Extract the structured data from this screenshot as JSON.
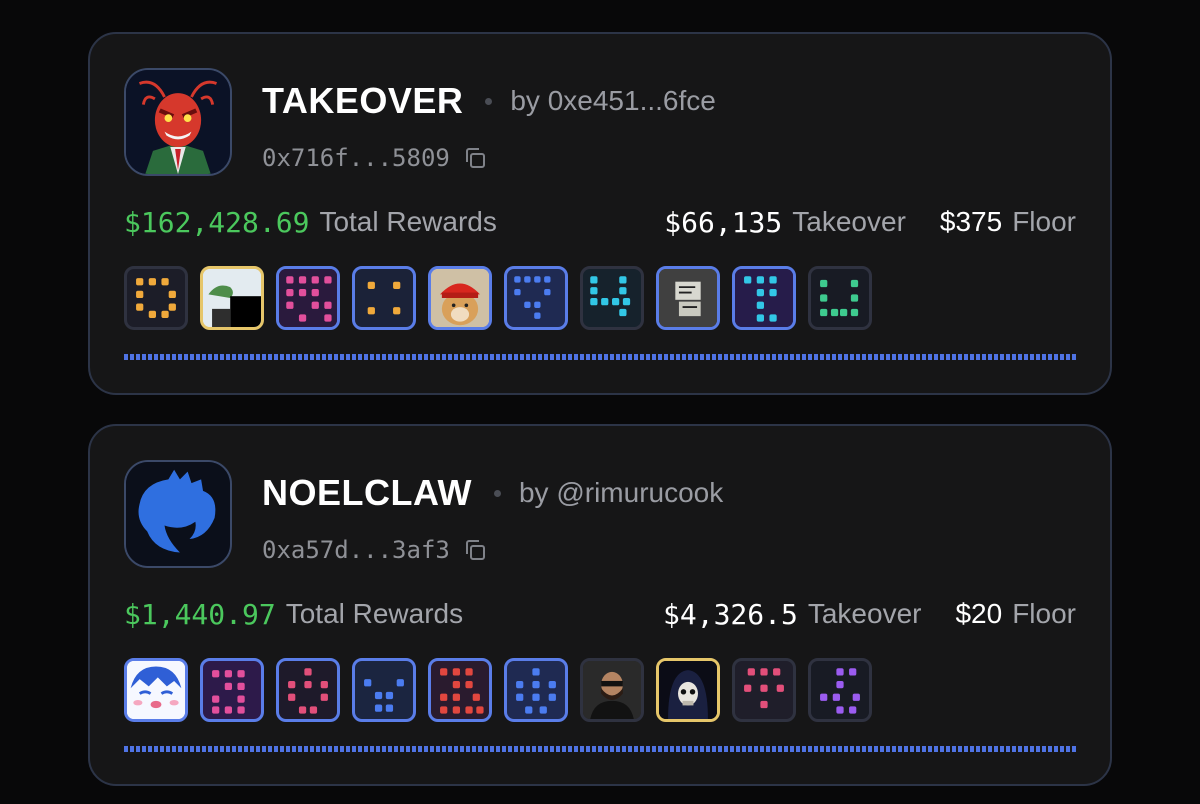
{
  "cards": [
    {
      "name": "TAKEOVER",
      "by": "by 0xe451...6fce",
      "address": "0x716f...5809",
      "total_rewards": "$162,428.69",
      "total_rewards_label": "Total Rewards",
      "takeover": "$66,135",
      "takeover_label": "Takeover",
      "floor": "$375",
      "floor_label": "Floor",
      "avatar_icon": "red-lobster-mascot-icon",
      "tiles": [
        "orange-pixel-tile",
        "pepe-frog-tile",
        "pink-pixel-tile",
        "orange-pixel-tile",
        "doge-red-cap-tile",
        "blue-pixel-tile",
        "cyan-pixel-tile",
        "sketch-art-tile",
        "cyan-pixel-tile",
        "green-pixel-tile"
      ]
    },
    {
      "name": "NOELCLAW",
      "by": "by @rimurucook",
      "address": "0xa57d...3af3",
      "total_rewards": "$1,440.97",
      "total_rewards_label": "Total Rewards",
      "takeover": "$4,326.5",
      "takeover_label": "Takeover",
      "floor": "$20",
      "floor_label": "Floor",
      "avatar_icon": "blue-claw-logo-icon",
      "tiles": [
        "anime-face-tile",
        "pink-pixel-tile",
        "pink-pixel-tile",
        "blue-pixel-tile",
        "red-pixel-tile",
        "blue-pixel-tile",
        "man-sunglasses-tile",
        "skull-hood-tile",
        "pink-pixel-tile",
        "purple-pixel-tile"
      ]
    }
  ],
  "colors": {
    "accent_green": "#4bc85d",
    "accent_blue": "#4f73e4",
    "card_border": "#2c3447",
    "gold_border": "#e6c66a"
  }
}
